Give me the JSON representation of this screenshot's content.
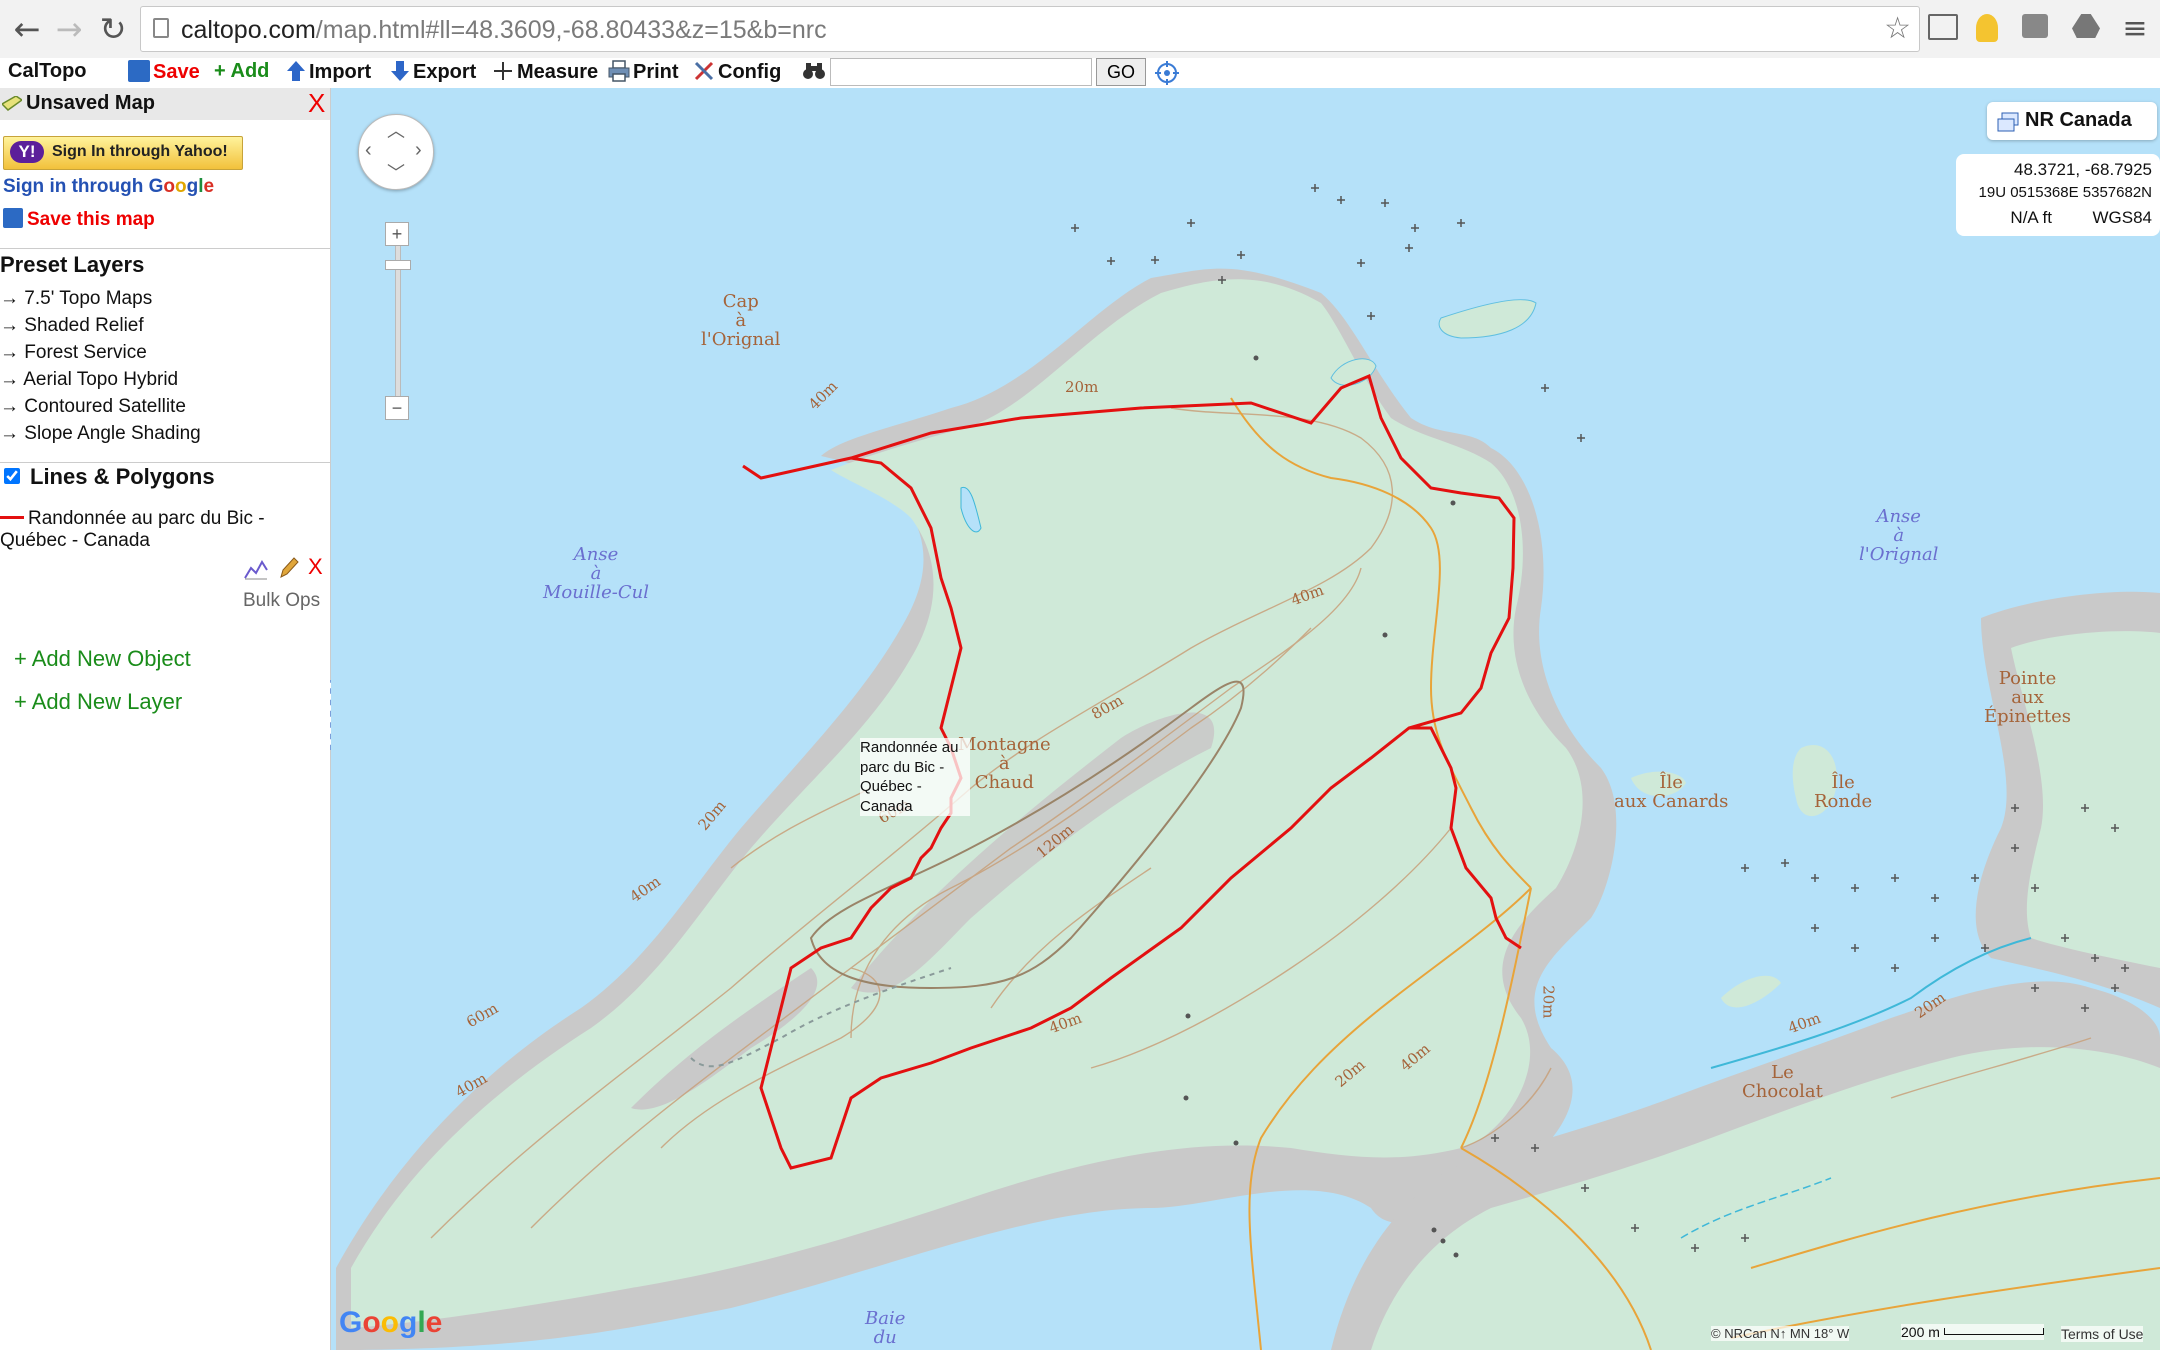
{
  "browser": {
    "url_host": "caltopo.com",
    "url_path": "/map.html#ll=48.3609,-68.80433&z=15&b=nrc"
  },
  "toolbar": {
    "brand": "CalTopo",
    "save_label": "Save",
    "add_label": "+ Add",
    "import_label": "Import",
    "export_label": "Export",
    "measure_label": "Measure",
    "print_label": "Print",
    "config_label": "Config",
    "search_value": "",
    "go_label": "GO"
  },
  "sidebar": {
    "title": "Unsaved Map",
    "close_label": "X",
    "yahoo_label": "Sign In through Yahoo!",
    "google_prefix": "Sign in through ",
    "google_word": [
      "G",
      "o",
      "o",
      "g",
      "l",
      "e"
    ],
    "save_map_label": "Save this map",
    "preset_heading": "Preset Layers",
    "presets": [
      "→ 7.5' Topo Maps",
      "→ Shaded Relief",
      "→ Forest Service",
      "→ Aerial Topo Hybrid",
      "→ Contoured Satellite",
      "→ Slope Angle Shading"
    ],
    "lines_heading": "Lines & Polygons",
    "lines_checked": true,
    "track_line1": "Randonnée au parc du Bic -",
    "track_line2": "Québec - Canada",
    "delete_label": "X",
    "bulk_ops": "Bulk Ops",
    "add_object": "+ Add New Object",
    "add_layer": "+ Add New Layer"
  },
  "map": {
    "layer_name": "NR Canada",
    "coords": {
      "latlon": "48.3721, -68.7925",
      "utm": "19U 0515368E 5357682N",
      "elev": "N/A ft",
      "datum": "WGS84"
    },
    "track_label": "Randonnée au parc du Bic - Québec - Canada",
    "places": {
      "cap_orignal": [
        "Cap",
        "à",
        "l'Orignal"
      ],
      "anse_mouille": [
        "Anse",
        "à",
        "Mouille-Cul"
      ],
      "anse_orignal": [
        "Anse",
        "à",
        "l'Orignal"
      ],
      "montagne": [
        "Montagne",
        "à",
        "Chaud"
      ],
      "ile_canards": [
        "Île",
        "aux Canards"
      ],
      "ile_ronde": [
        "Île",
        "Ronde"
      ],
      "pointe": [
        "Pointe",
        "aux",
        "Épinettes"
      ],
      "chocolat": [
        "Le",
        "Chocolat"
      ],
      "baie": [
        "Baie",
        "du"
      ]
    },
    "contours": [
      "40m",
      "20m",
      "40m",
      "80m",
      "60m",
      "120m",
      "20m",
      "40m",
      "60m",
      "40m",
      "40m",
      "20m",
      "40m",
      "20m",
      "40m",
      "20m"
    ],
    "google": [
      "G",
      "o",
      "o",
      "g",
      "l",
      "e"
    ],
    "attribution": "© NRCan  N↑ MN 18° W",
    "scale": "200 m",
    "terms": "Terms of Use"
  },
  "colors": {
    "water": "#b5e1f9",
    "land": "#cfe9d8",
    "rock": "#c9c9c9",
    "track": "#e31010",
    "road": "#e8a43a",
    "google_blue": "#4285f4",
    "google_red": "#ea4335",
    "google_yellow": "#fbbc05",
    "google_green": "#34a853"
  }
}
